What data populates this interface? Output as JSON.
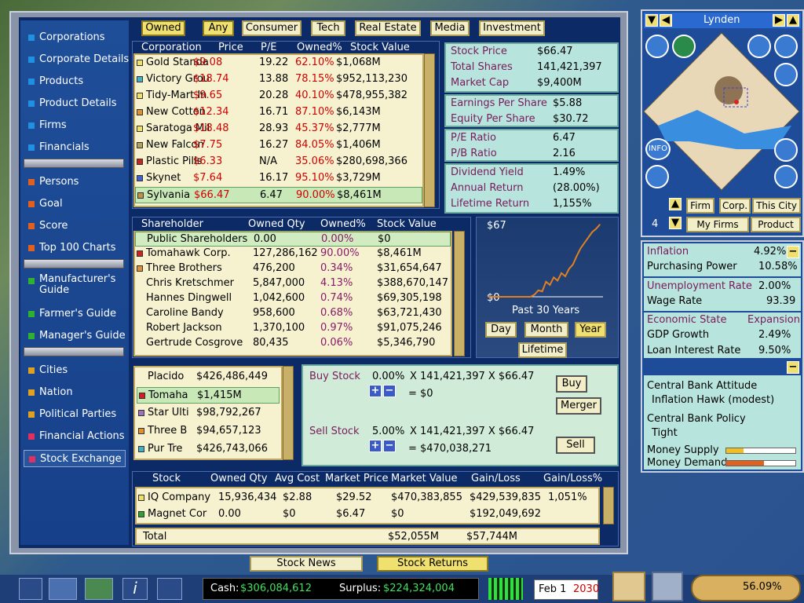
{
  "nav": {
    "items": [
      {
        "label": "Corporations",
        "color": "#2090e0"
      },
      {
        "label": "Corporate Details",
        "color": "#2090e0"
      },
      {
        "label": "Products",
        "color": "#2090e0"
      },
      {
        "label": "Product Details",
        "color": "#2090e0"
      },
      {
        "label": "Firms",
        "color": "#2090e0"
      },
      {
        "label": "Financials",
        "color": "#2090e0"
      },
      {
        "label": "Persons",
        "color": "#e06020"
      },
      {
        "label": "Goal",
        "color": "#e06020"
      },
      {
        "label": "Score",
        "color": "#e06020"
      },
      {
        "label": "Top 100 Charts",
        "color": "#e06020"
      },
      {
        "label": "Manufacturer's Guide",
        "color": "#30b030"
      },
      {
        "label": "Farmer's Guide",
        "color": "#30b030"
      },
      {
        "label": "Manager's Guide",
        "color": "#30b030"
      },
      {
        "label": "Cities",
        "color": "#e0a020"
      },
      {
        "label": "Nation",
        "color": "#e0a020"
      },
      {
        "label": "Political Parties",
        "color": "#e0a020"
      },
      {
        "label": "Financial Actions",
        "color": "#e03060"
      },
      {
        "label": "Stock Exchange",
        "color": "#e03060"
      }
    ]
  },
  "filters": {
    "owned": "Owned",
    "any": "Any",
    "consumer": "Consumer",
    "tech": "Tech",
    "real_estate": "Real Estate",
    "media": "Media",
    "investment": "Investment"
  },
  "corp_table": {
    "headers": [
      "Corporation",
      "Price",
      "P/E",
      "Owned%",
      "Stock Value"
    ],
    "rows": [
      {
        "color": "#f0e060",
        "name": "Gold Standa",
        "price": "$9.08",
        "pe": "19.22",
        "owned": "62.10%",
        "value": "$1,068M"
      },
      {
        "color": "#40b0c8",
        "name": "Victory Grou",
        "price": "$18.74",
        "pe": "13.88",
        "owned": "78.15%",
        "value": "$952,113,230"
      },
      {
        "color": "#f0e060",
        "name": "Tidy-Mart In",
        "price": "$9.65",
        "pe": "20.28",
        "owned": "40.10%",
        "value": "$478,955,382"
      },
      {
        "color": "#e09030",
        "name": "New Cotton",
        "price": "$12.34",
        "pe": "16.71",
        "owned": "87.10%",
        "value": "$6,143M"
      },
      {
        "color": "#f0e060",
        "name": "Saratoga Mil",
        "price": "$18.48",
        "pe": "28.93",
        "owned": "45.37%",
        "value": "$2,777M"
      },
      {
        "color": "#b0a060",
        "name": "New Falcon",
        "price": "$7.75",
        "pe": "16.27",
        "owned": "84.05%",
        "value": "$1,406M"
      },
      {
        "color": "#d02020",
        "name": "Plastic Pills",
        "price": "$6.33",
        "pe": "N/A",
        "owned": "35.06%",
        "value": "$280,698,366"
      },
      {
        "color": "#4060d0",
        "name": "Skynet",
        "price": "$7.64",
        "pe": "16.17",
        "owned": "95.10%",
        "value": "$3,729M"
      },
      {
        "color": "#c09050",
        "name": "Sylvania",
        "price": "$66.47",
        "pe": "6.47",
        "owned": "90.00%",
        "value": "$8,461M"
      }
    ]
  },
  "stock_info": {
    "stock_price_label": "Stock Price",
    "stock_price": "$66.47",
    "total_shares_label": "Total Shares",
    "total_shares": "141,421,397",
    "market_cap_label": "Market Cap",
    "market_cap": "$9,400M",
    "eps_label": "Earnings Per Share",
    "eps": "$5.88",
    "equity_label": "Equity Per Share",
    "equity": "$30.72",
    "pe_label": "P/E Ratio",
    "pe": "6.47",
    "pb_label": "P/B Ratio",
    "pb": "2.16",
    "div_label": "Dividend Yield",
    "div": "1.49%",
    "annual_label": "Annual Return",
    "annual": "(28.00%)",
    "lifetime_label": "Lifetime Return",
    "lifetime": "1,155%"
  },
  "shareholders": {
    "headers": [
      "Shareholder",
      "Owned Qty",
      "Owned%",
      "Stock Value"
    ],
    "rows": [
      {
        "color": "",
        "name": "Public Shareholders",
        "qty": "0.00",
        "pct": "0.00%",
        "value": "$0"
      },
      {
        "color": "#d02020",
        "name": "Tomahawk Corp.",
        "qty": "127,286,162",
        "pct": "90.00%",
        "value": "$8,461M"
      },
      {
        "color": "#e09030",
        "name": "Three Brothers",
        "qty": "476,200",
        "pct": "0.34%",
        "value": "$31,654,647"
      },
      {
        "color": "",
        "name": "Chris Kretschmer",
        "qty": "5,847,000",
        "pct": "4.13%",
        "value": "$388,670,147"
      },
      {
        "color": "",
        "name": "Hannes Dingwell",
        "qty": "1,042,600",
        "pct": "0.74%",
        "value": "$69,305,198"
      },
      {
        "color": "",
        "name": "Caroline Bandy",
        "qty": "958,600",
        "pct": "0.68%",
        "value": "$63,721,430"
      },
      {
        "color": "",
        "name": "Robert Jackson",
        "qty": "1,370,100",
        "pct": "0.97%",
        "value": "$91,075,246"
      },
      {
        "color": "",
        "name": "Gertrude Cosgrove",
        "qty": "80,435",
        "pct": "0.06%",
        "value": "$5,346,790"
      }
    ]
  },
  "chart_data": {
    "type": "line",
    "title": "Past 30 Years",
    "ymax_label": "$67",
    "ymin_label": "$0",
    "x": [
      0,
      1,
      2,
      3,
      4,
      5,
      6,
      7,
      8,
      9,
      10,
      11,
      12,
      13,
      14,
      15,
      16,
      17,
      18,
      19,
      20,
      21,
      22,
      23,
      24,
      25,
      26,
      27,
      28,
      29
    ],
    "values": [
      0,
      0,
      0,
      0,
      0,
      0,
      0,
      0,
      0,
      0,
      0,
      0,
      2,
      6,
      5,
      14,
      11,
      18,
      15,
      22,
      19,
      26,
      30,
      38,
      45,
      50,
      55,
      60,
      63,
      67
    ],
    "ylim": [
      0,
      67
    ],
    "color": "#e08020"
  },
  "periods": {
    "day": "Day",
    "month": "Month",
    "year": "Year",
    "lifetime": "Lifetime"
  },
  "holders_small": [
    {
      "color": "",
      "name": "Placido",
      "value": "$426,486,449"
    },
    {
      "color": "#d02020",
      "name": "Tomaha",
      "value": "$1,415M"
    },
    {
      "color": "#a070c0",
      "name": "Star Ulti",
      "value": "$98,792,267"
    },
    {
      "color": "#e09030",
      "name": "Three B",
      "value": "$94,657,123"
    },
    {
      "color": "#40b0c8",
      "name": "Pur Tre",
      "value": "$426,743,066"
    }
  ],
  "trade": {
    "buy_label": "Buy Stock",
    "buy_pct": "0.00%",
    "buy_expr": "X 141,421,397 X $66.47",
    "buy_result": "= $0",
    "sell_label": "Sell Stock",
    "sell_pct": "5.00%",
    "sell_expr": "X 141,421,397 X $66.47",
    "sell_result": "= $470,038,271",
    "buy_btn": "Buy",
    "merger_btn": "Merger",
    "sell_btn": "Sell"
  },
  "portfolio": {
    "headers": [
      "Stock",
      "Owned Qty",
      "Avg Cost",
      "Market Price",
      "Market Value",
      "Gain/Loss",
      "Gain/Loss%"
    ],
    "rows": [
      {
        "color": "#f0e060",
        "name": "IQ Company",
        "qty": "15,936,434",
        "avg": "$2.88",
        "mkt": "$29.52",
        "value": "$470,383,855",
        "gain": "$429,539,835",
        "gainpct": "1,051%"
      },
      {
        "color": "#30a030",
        "name": "Magnet Cor",
        "qty": "0.00",
        "avg": "$0",
        "mkt": "$6.47",
        "value": "$0",
        "gain": "$192,049,692",
        "gainpct": ""
      }
    ],
    "total_label": "Total",
    "total_value": "$52,055M",
    "total_gain": "$57,744M"
  },
  "bottom_tabs": {
    "news": "Stock News",
    "returns": "Stock Returns"
  },
  "city": {
    "name": "Lynden"
  },
  "rp_tabs": {
    "firm": "Firm",
    "corp": "Corp.",
    "this_city": "This City",
    "num": "4",
    "my_firms": "My Firms",
    "product": "Product"
  },
  "econ": {
    "inflation_label": "Inflation",
    "inflation": "4.92%",
    "purchasing_label": "Purchasing Power",
    "purchasing": "10.58%",
    "unemp_label": "Unemployment Rate",
    "unemp": "2.00%",
    "wage_label": "Wage Rate",
    "wage": "93.39",
    "state_label": "Economic State",
    "state": "Expansion",
    "gdp_label": "GDP Growth",
    "gdp": "2.49%",
    "loan_label": "Loan Interest Rate",
    "loan": "9.50%",
    "attitude_label": "Central Bank Attitude",
    "attitude": "Inflation Hawk (modest)",
    "policy_label": "Central Bank Policy",
    "policy": "Tight",
    "supply_label": "Money Supply",
    "demand_label": "Money Demand",
    "supply_level": 0.25,
    "demand_level": 0.55
  },
  "status": {
    "cash_label": "Cash:",
    "cash": "$306,084,612",
    "surplus_label": "Surplus:",
    "surplus": "$224,324,004",
    "date": "Feb 1",
    "year": "2030",
    "approval": "56.09%",
    "info_btn": "INFO"
  }
}
